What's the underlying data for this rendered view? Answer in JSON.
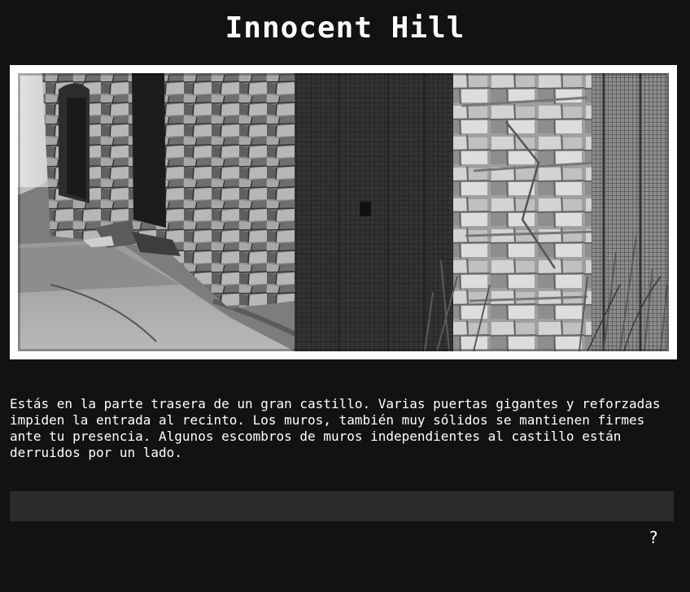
{
  "game": {
    "title": "Innocent Hill"
  },
  "scene": {
    "description": "Estás en la parte trasera de un gran castillo. Varias puertas gigantes y reforzadas impiden la entrada al recinto. Los muros, también muy sólidos se mantienen firmes ante tu presencia. Algunos escombros de muros independientes al castillo están derruidos por un lado."
  },
  "command": {
    "value": "",
    "placeholder": ""
  },
  "help": {
    "label": "?"
  }
}
